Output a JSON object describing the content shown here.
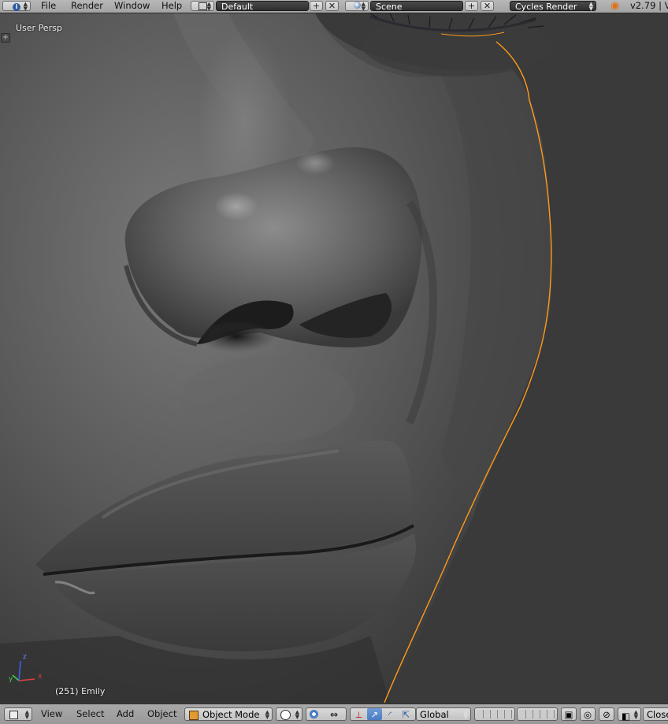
{
  "top_header": {
    "menu": [
      "File",
      "Render",
      "Window",
      "Help"
    ],
    "screen_layout": "Default",
    "scene": "Scene",
    "render_engine": "Cycles Render",
    "version": "v2.79 | V"
  },
  "viewport": {
    "view_label": "User Persp",
    "object_label": "(251) Emily",
    "axes": {
      "x": "x",
      "y": "y",
      "z": "z"
    },
    "colors": {
      "background": "#3d3d3d",
      "selection_outline": "#ff9a1a",
      "axis_x": "#e04040",
      "axis_y": "#40d040",
      "axis_z": "#4060ff"
    }
  },
  "bottom_header": {
    "menu": [
      "View",
      "Select",
      "Add",
      "Object"
    ],
    "mode": "Object Mode",
    "orientation": "Global",
    "close_label": "Close"
  }
}
